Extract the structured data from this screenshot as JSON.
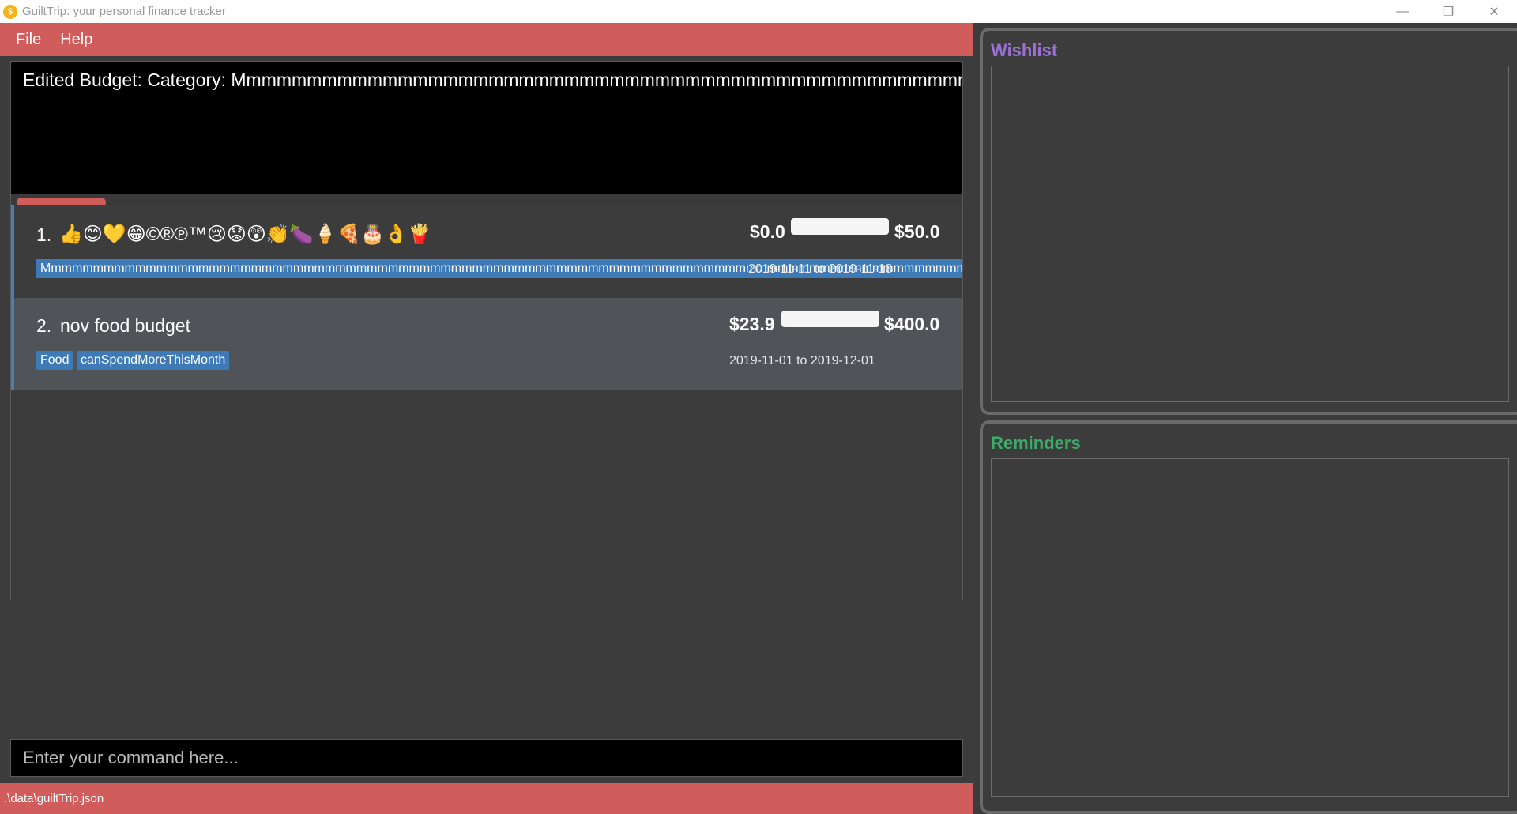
{
  "window": {
    "title": "GuiltTrip: your personal finance tracker",
    "app_icon_glyph": "$"
  },
  "menu": {
    "file": "File",
    "help": "Help"
  },
  "result": {
    "text": "Edited Budget: Category: Mmmmmmmmmmmmmmmmmmmmmmmmmmmmmmmmmmmmmmmmmmmmmmmmmmm"
  },
  "budgets": [
    {
      "index": "1.",
      "name": "👍😊💛😁©®℗™😢😟😲👏🍆🍦🍕🎂👌🍟",
      "spent": "$0.0",
      "total": "$50.0",
      "progress": 0,
      "tag_long": "Mmmmmmmmmmmmmmmmmmmmmmmmmmmmmmmmmmmmmmmmmmmmmmmmmmmmmmmmmmmmmmmmmmmmmmmmmmmmmmmmmmmmmmmmmmmmmmmmmmmmmmmmm",
      "date": "2019-11-11 to 2019-11-18"
    },
    {
      "index": "2.",
      "name": "nov food budget",
      "spent": "$23.9",
      "total": "$400.0",
      "progress": 0.06,
      "tags": [
        "Food",
        "canSpendMoreThisMonth"
      ],
      "date": "2019-11-01 to 2019-12-01"
    }
  ],
  "command": {
    "placeholder": "Enter your command here..."
  },
  "status": {
    "path": ".\\data\\guiltTrip.json"
  },
  "panels": {
    "wishlist_title": "Wishlist",
    "reminders_title": "Reminders"
  },
  "colors": {
    "accent": "#d05c5c",
    "tag": "#3e7bb6",
    "wishlist_title": "#9a6fd6",
    "reminders_title": "#3bab68"
  }
}
